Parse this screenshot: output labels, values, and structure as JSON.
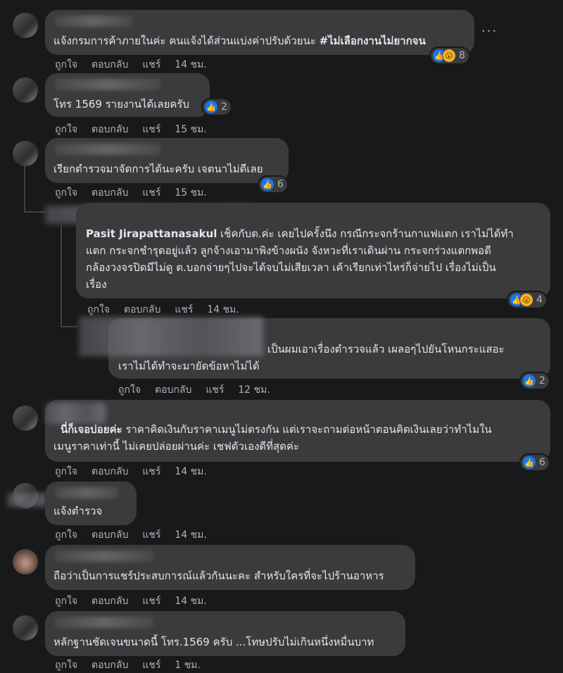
{
  "comments": [
    {
      "text": "แจ้งกรมการค้าภายในค่ะ คนแจ้งได้ส่วนแบ่งค่าปรับด้วยนะ",
      "hashtag": "#ไม่เลือกงานไม่ยากจน",
      "reactions": "8",
      "time": "14 ชม."
    },
    {
      "text": "โทร 1569 รายงานได้เลยครับ",
      "reactions": "2",
      "time": "15 ชม."
    },
    {
      "text": "เรียกตำรวจมาจัดการได้นะครับ เจตนาไม่ดีเลย",
      "reactions": "6",
      "time": "15 ชม."
    },
    {
      "name": "Pasit Jirapattanasakul",
      "line1": "เช็คกับต.ค่ะ เคยไปครั้งนึง กรณีกระจกร้านกาแฟแตก เราไม่ได้ทำ",
      "line2": "แตก กระจกชำรุดอยู่แล้ว ลูกจ้างเอามาพิงข้างผนัง จังหวะที่เราเดินผ่าน กระจกร่วงแตกพอดี",
      "line3": "กล้องวงจรปิดมีไม่ดู ต.บอกจ่ายๆไปจะได้จบไม่เสียเวลา เค้าเรียกเท่าไหร่ก็จ่ายไป เรื่องไม่เป็น",
      "line4": "เรื่อง",
      "reactions": "4",
      "time": "14 ชม."
    },
    {
      "line1": "เป็นผมเอาเรื่องตำรวจแล้ว เผลอๆไปยันโหนกระแสอะ",
      "line2": "เราไม่ได้ทำจะมายัดข้อหาไม่ได้",
      "reactions": "2",
      "time": "12 ชม."
    },
    {
      "name": "นี่ก็เจอบ่อยค่ะ",
      "line1": "ราคาคิดเงินกับราคาเมนูไม่ตรงกัน แต่เราจะถามต่อหน้าตอนคิดเงินเลยว่าทำไมใน",
      "line2": "เมนูราคาเท่านี้ ไม่เคยปล่อยผ่านค่ะ เชฟตัวเองดีที่สุดค่ะ",
      "reactions": "6",
      "time": "14 ชม."
    },
    {
      "text": "แจ้งตำรวจ",
      "time": "14 ชม."
    },
    {
      "text": "ถือว่าเป็นการแชร์ประสบการณ์แล้วกันนะคะ สำหรับใครที่จะไปร้านอาหาร",
      "time": "14 ชม."
    },
    {
      "text": "หลักฐานชัดเจนขนาดนี้ โทร.1569 ครับ ...โทษปรับไม่เกินหนึ่งหมื่นบาท",
      "time": "1 ชม."
    }
  ],
  "actions": {
    "like": "ถูกใจ",
    "reply": "ตอบกลับ",
    "share": "แชร์"
  },
  "more_label": "···",
  "icons": {
    "like": "like-reaction-icon",
    "wow": "wow-reaction-icon",
    "more": "more-options-icon"
  },
  "colors": {
    "background": "#18191a",
    "bubble": "#3a3b3c",
    "like": "#1877f2",
    "wow": "#f7b125"
  }
}
